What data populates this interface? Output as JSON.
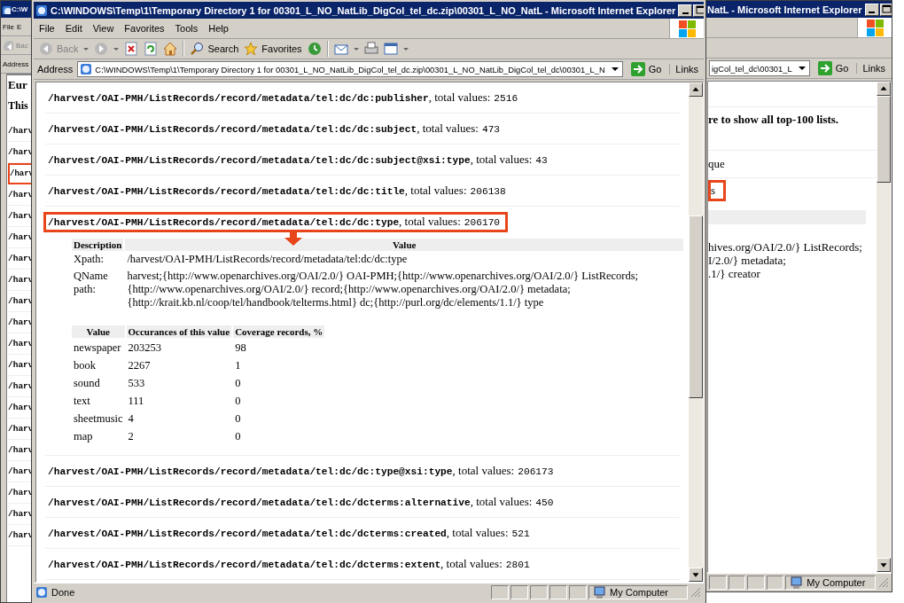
{
  "back_left_window": {
    "title": "C:\\W",
    "menu": [
      "File",
      "E"
    ],
    "back": "Bac",
    "address_label": "Address",
    "heading": "Eur",
    "intro": "This",
    "rows": [
      {
        "text": "/harv",
        "highlighted": false
      },
      {
        "text": "/harv",
        "highlighted": false
      },
      {
        "text": "/harv",
        "highlighted": true
      },
      {
        "text": "/harv",
        "highlighted": false
      },
      {
        "text": "/harv",
        "highlighted": false
      },
      {
        "text": "/harv",
        "highlighted": false
      },
      {
        "text": "/harv",
        "highlighted": false
      },
      {
        "text": "/harv",
        "highlighted": false
      },
      {
        "text": "/harv",
        "highlighted": false
      },
      {
        "text": "/harv",
        "highlighted": false
      },
      {
        "text": "/harv",
        "highlighted": false
      },
      {
        "text": "/harv",
        "highlighted": false
      },
      {
        "text": "/harv",
        "highlighted": false
      },
      {
        "text": "/harv",
        "highlighted": false
      },
      {
        "text": "/harv",
        "highlighted": false
      },
      {
        "text": "/harv",
        "highlighted": false
      },
      {
        "text": "/harv",
        "highlighted": false
      },
      {
        "text": "/harv",
        "highlighted": false
      },
      {
        "text": "/harv",
        "highlighted": false
      },
      {
        "text": "/harv",
        "highlighted": false
      }
    ]
  },
  "back_right_window": {
    "title": "NatL - Microsoft Internet Explorer",
    "address_value": "igCol_tel_dc\\00301_L",
    "go": "Go",
    "links": "Links",
    "link_line": "re to show all top-100 lists.",
    "rows": [
      {
        "text": "que",
        "highlighted": false
      },
      {
        "text": "s",
        "highlighted": true
      }
    ],
    "detail_lines": [
      "hives.org/OAI/2.0/} ListRecords;",
      "I/2.0/} metadata;",
      ".1/} creator"
    ],
    "status_zone": "My Computer"
  },
  "window": {
    "title": "C:\\WINDOWS\\Temp\\1\\Temporary Directory 1 for 00301_L_NO_NatLib_DigCol_tel_dc.zip\\00301_L_NO_NatL - Microsoft Internet Explorer",
    "menu": [
      "File",
      "Edit",
      "View",
      "Favorites",
      "Tools",
      "Help"
    ],
    "toolbar": {
      "back": "Back",
      "search": "Search",
      "favorites": "Favorites"
    },
    "address": {
      "label": "Address",
      "value": "C:\\WINDOWS\\Temp\\1\\Temporary Directory 1 for 00301_L_NO_NatLib_DigCol_tel_dc.zip\\00301_L_NO_NatLib_DigCol_tel_dc\\00301_L_N",
      "go": "Go",
      "links": "Links"
    },
    "records": [
      {
        "path": "/harvest/OAI-PMH/ListRecords/record/metadata/tel:dc/dc:publisher",
        "label": ", total values:",
        "count": "2516",
        "highlighted": false
      },
      {
        "path": "/harvest/OAI-PMH/ListRecords/record/metadata/tel:dc/dc:subject",
        "label": ", total values:",
        "count": "473",
        "highlighted": false
      },
      {
        "path": "/harvest/OAI-PMH/ListRecords/record/metadata/tel:dc/dc:subject@xsi:type",
        "label": ", total values:",
        "count": "43",
        "highlighted": false
      },
      {
        "path": "/harvest/OAI-PMH/ListRecords/record/metadata/tel:dc/dc:title",
        "label": ", total values:",
        "count": "206138",
        "highlighted": false
      },
      {
        "path": "/harvest/OAI-PMH/ListRecords/record/metadata/tel:dc/dc:type",
        "label": ", total values:",
        "count": "206170",
        "highlighted": true,
        "details": {
          "columns": [
            "Description",
            "Value"
          ],
          "rows": [
            {
              "label": "Xpath:",
              "value": "/harvest/OAI-PMH/ListRecords/record/metadata/tel:dc/dc:type"
            },
            {
              "label": "QName path:",
              "value": "harvest;{http://www.openarchives.org/OAI/2.0/} OAI-PMH;{http://www.openarchives.org/OAI/2.0/} ListRecords;{http://www.openarchives.org/OAI/2.0/} record;{http://www.openarchives.org/OAI/2.0/} metadata;{http://krait.kb.nl/coop/tel/handbook/telterms.html} dc;{http://purl.org/dc/elements/1.1/} type"
            }
          ],
          "values_columns": [
            "Value",
            "Occurances of this value",
            "Coverage records, %"
          ],
          "values_rows": [
            [
              "newspaper",
              "203253",
              "98"
            ],
            [
              "book",
              "2267",
              "1"
            ],
            [
              "sound",
              "533",
              "0"
            ],
            [
              "text",
              "111",
              "0"
            ],
            [
              "sheetmusic",
              "4",
              "0"
            ],
            [
              "map",
              "2",
              "0"
            ]
          ]
        }
      },
      {
        "path": "/harvest/OAI-PMH/ListRecords/record/metadata/tel:dc/dc:type@xsi:type",
        "label": ", total values:",
        "count": "206173",
        "highlighted": false
      },
      {
        "path": "/harvest/OAI-PMH/ListRecords/record/metadata/tel:dc/dcterms:alternative",
        "label": ", total values:",
        "count": "450",
        "highlighted": false
      },
      {
        "path": "/harvest/OAI-PMH/ListRecords/record/metadata/tel:dc/dcterms:created",
        "label": ", total values:",
        "count": "521",
        "highlighted": false
      },
      {
        "path": "/harvest/OAI-PMH/ListRecords/record/metadata/tel:dc/dcterms:extent",
        "label": ", total values:",
        "count": "2801",
        "highlighted": false
      }
    ],
    "status_bar": {
      "text": "Done",
      "zone": "My Computer"
    }
  }
}
